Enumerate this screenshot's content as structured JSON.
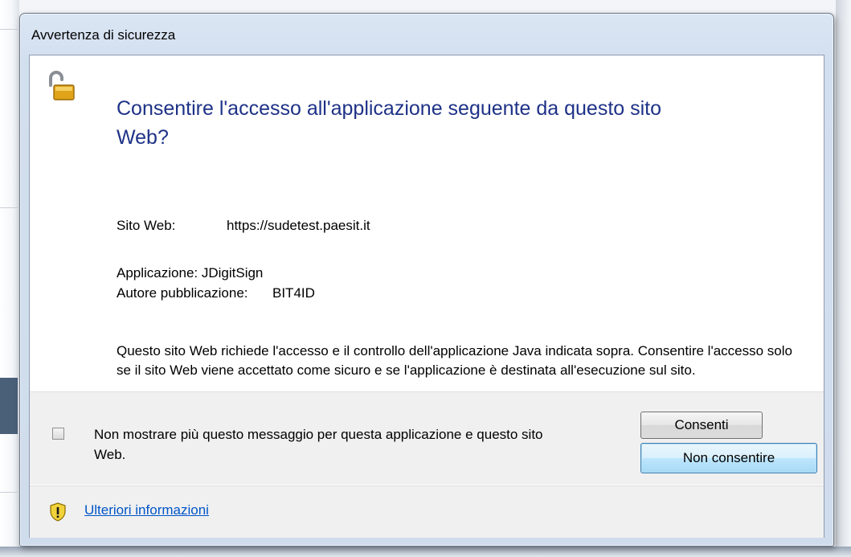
{
  "window": {
    "title": "Avvertenza di sicurezza"
  },
  "dialog": {
    "heading_line1": "Consentire l'accesso all'applicazione seguente da questo sito",
    "heading_line2": "Web?",
    "site_label": "Sito Web:",
    "site_value": "https://sudetest.paesit.it",
    "application_line": "Applicazione: JDigitSign",
    "author_label": "Autore pubblicazione:",
    "author_value": "BIT4ID",
    "paragraph": "Questo sito Web richiede l'accesso e il controllo dell'applicazione Java indicata sopra. Consentire l'accesso solo se il sito Web viene accettato come sicuro e se l'applicazione è destinata all'esecuzione sul sito."
  },
  "options": {
    "checkbox_checked": false,
    "checkbox_label": "Non mostrare più questo messaggio per questa applicazione e questo sito Web."
  },
  "buttons": {
    "allow": "Consenti",
    "deny": "Non consentire"
  },
  "footer": {
    "more_info_link": "Ulteriori informazioni"
  },
  "icons": {
    "main": "unlocked-padlock-icon",
    "footer": "shield-warning-icon"
  },
  "colors": {
    "heading": "#1e3287",
    "link": "#0055c8"
  }
}
